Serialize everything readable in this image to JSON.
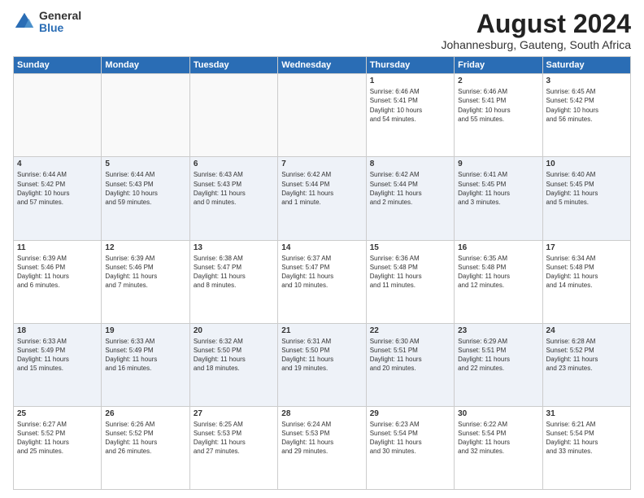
{
  "logo": {
    "general": "General",
    "blue": "Blue"
  },
  "header": {
    "title": "August 2024",
    "subtitle": "Johannesburg, Gauteng, South Africa"
  },
  "weekdays": [
    "Sunday",
    "Monday",
    "Tuesday",
    "Wednesday",
    "Thursday",
    "Friday",
    "Saturday"
  ],
  "weeks": [
    [
      {
        "day": "",
        "info": ""
      },
      {
        "day": "",
        "info": ""
      },
      {
        "day": "",
        "info": ""
      },
      {
        "day": "",
        "info": ""
      },
      {
        "day": "1",
        "info": "Sunrise: 6:46 AM\nSunset: 5:41 PM\nDaylight: 10 hours\nand 54 minutes."
      },
      {
        "day": "2",
        "info": "Sunrise: 6:46 AM\nSunset: 5:41 PM\nDaylight: 10 hours\nand 55 minutes."
      },
      {
        "day": "3",
        "info": "Sunrise: 6:45 AM\nSunset: 5:42 PM\nDaylight: 10 hours\nand 56 minutes."
      }
    ],
    [
      {
        "day": "4",
        "info": "Sunrise: 6:44 AM\nSunset: 5:42 PM\nDaylight: 10 hours\nand 57 minutes."
      },
      {
        "day": "5",
        "info": "Sunrise: 6:44 AM\nSunset: 5:43 PM\nDaylight: 10 hours\nand 59 minutes."
      },
      {
        "day": "6",
        "info": "Sunrise: 6:43 AM\nSunset: 5:43 PM\nDaylight: 11 hours\nand 0 minutes."
      },
      {
        "day": "7",
        "info": "Sunrise: 6:42 AM\nSunset: 5:44 PM\nDaylight: 11 hours\nand 1 minute."
      },
      {
        "day": "8",
        "info": "Sunrise: 6:42 AM\nSunset: 5:44 PM\nDaylight: 11 hours\nand 2 minutes."
      },
      {
        "day": "9",
        "info": "Sunrise: 6:41 AM\nSunset: 5:45 PM\nDaylight: 11 hours\nand 3 minutes."
      },
      {
        "day": "10",
        "info": "Sunrise: 6:40 AM\nSunset: 5:45 PM\nDaylight: 11 hours\nand 5 minutes."
      }
    ],
    [
      {
        "day": "11",
        "info": "Sunrise: 6:39 AM\nSunset: 5:46 PM\nDaylight: 11 hours\nand 6 minutes."
      },
      {
        "day": "12",
        "info": "Sunrise: 6:39 AM\nSunset: 5:46 PM\nDaylight: 11 hours\nand 7 minutes."
      },
      {
        "day": "13",
        "info": "Sunrise: 6:38 AM\nSunset: 5:47 PM\nDaylight: 11 hours\nand 8 minutes."
      },
      {
        "day": "14",
        "info": "Sunrise: 6:37 AM\nSunset: 5:47 PM\nDaylight: 11 hours\nand 10 minutes."
      },
      {
        "day": "15",
        "info": "Sunrise: 6:36 AM\nSunset: 5:48 PM\nDaylight: 11 hours\nand 11 minutes."
      },
      {
        "day": "16",
        "info": "Sunrise: 6:35 AM\nSunset: 5:48 PM\nDaylight: 11 hours\nand 12 minutes."
      },
      {
        "day": "17",
        "info": "Sunrise: 6:34 AM\nSunset: 5:48 PM\nDaylight: 11 hours\nand 14 minutes."
      }
    ],
    [
      {
        "day": "18",
        "info": "Sunrise: 6:33 AM\nSunset: 5:49 PM\nDaylight: 11 hours\nand 15 minutes."
      },
      {
        "day": "19",
        "info": "Sunrise: 6:33 AM\nSunset: 5:49 PM\nDaylight: 11 hours\nand 16 minutes."
      },
      {
        "day": "20",
        "info": "Sunrise: 6:32 AM\nSunset: 5:50 PM\nDaylight: 11 hours\nand 18 minutes."
      },
      {
        "day": "21",
        "info": "Sunrise: 6:31 AM\nSunset: 5:50 PM\nDaylight: 11 hours\nand 19 minutes."
      },
      {
        "day": "22",
        "info": "Sunrise: 6:30 AM\nSunset: 5:51 PM\nDaylight: 11 hours\nand 20 minutes."
      },
      {
        "day": "23",
        "info": "Sunrise: 6:29 AM\nSunset: 5:51 PM\nDaylight: 11 hours\nand 22 minutes."
      },
      {
        "day": "24",
        "info": "Sunrise: 6:28 AM\nSunset: 5:52 PM\nDaylight: 11 hours\nand 23 minutes."
      }
    ],
    [
      {
        "day": "25",
        "info": "Sunrise: 6:27 AM\nSunset: 5:52 PM\nDaylight: 11 hours\nand 25 minutes."
      },
      {
        "day": "26",
        "info": "Sunrise: 6:26 AM\nSunset: 5:52 PM\nDaylight: 11 hours\nand 26 minutes."
      },
      {
        "day": "27",
        "info": "Sunrise: 6:25 AM\nSunset: 5:53 PM\nDaylight: 11 hours\nand 27 minutes."
      },
      {
        "day": "28",
        "info": "Sunrise: 6:24 AM\nSunset: 5:53 PM\nDaylight: 11 hours\nand 29 minutes."
      },
      {
        "day": "29",
        "info": "Sunrise: 6:23 AM\nSunset: 5:54 PM\nDaylight: 11 hours\nand 30 minutes."
      },
      {
        "day": "30",
        "info": "Sunrise: 6:22 AM\nSunset: 5:54 PM\nDaylight: 11 hours\nand 32 minutes."
      },
      {
        "day": "31",
        "info": "Sunrise: 6:21 AM\nSunset: 5:54 PM\nDaylight: 11 hours\nand 33 minutes."
      }
    ]
  ]
}
